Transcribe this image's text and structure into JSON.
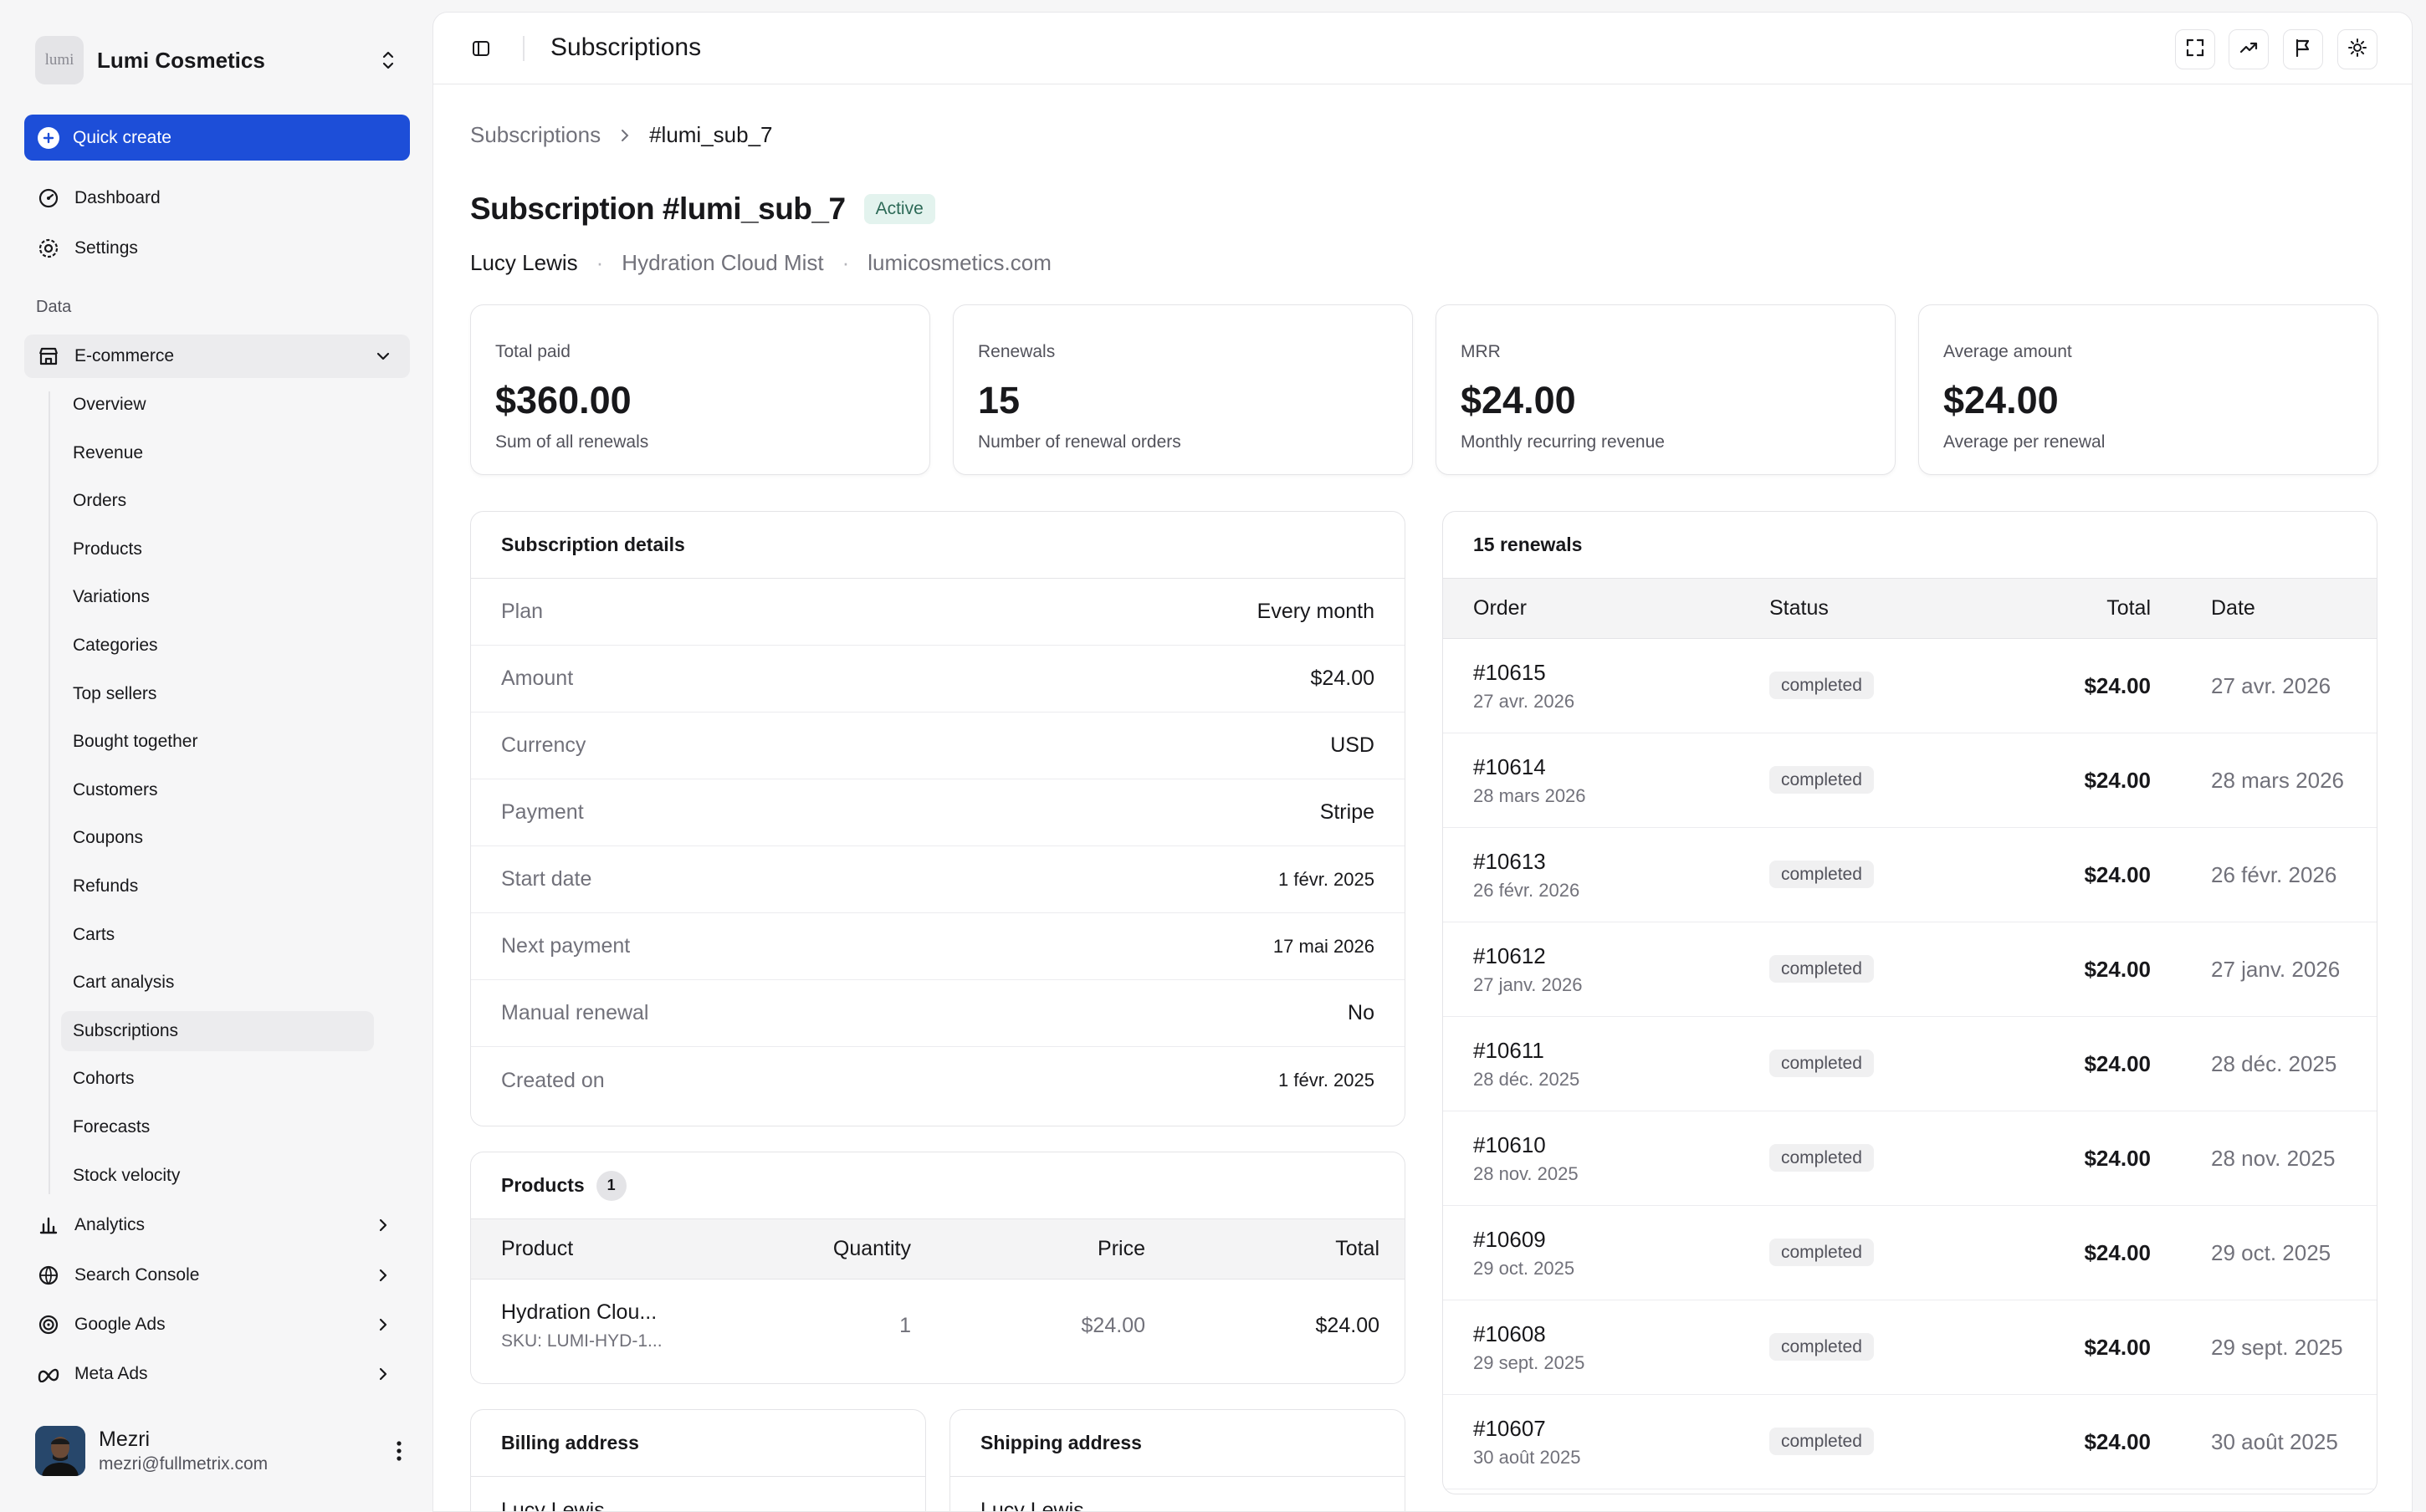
{
  "sidebar": {
    "brand": {
      "logo_text": "lumi",
      "name": "Lumi Cosmetics"
    },
    "quick_create": "Quick create",
    "top_items": [
      {
        "label": "Dashboard",
        "icon": "dashboard-icon"
      },
      {
        "label": "Settings",
        "icon": "gear-icon"
      }
    ],
    "section_label": "Data",
    "ecommerce": {
      "label": "E-commerce",
      "items": [
        "Overview",
        "Revenue",
        "Orders",
        "Products",
        "Variations",
        "Categories",
        "Top sellers",
        "Bought together",
        "Customers",
        "Coupons",
        "Refunds",
        "Carts",
        "Cart analysis",
        "Subscriptions",
        "Cohorts",
        "Forecasts",
        "Stock velocity"
      ],
      "active": "Subscriptions"
    },
    "groups": [
      {
        "label": "Analytics",
        "icon": "bar-chart-icon"
      },
      {
        "label": "Search Console",
        "icon": "search-console-icon"
      },
      {
        "label": "Google Ads",
        "icon": "google-ads-icon"
      },
      {
        "label": "Meta Ads",
        "icon": "meta-icon"
      }
    ],
    "user": {
      "name": "Mezri",
      "email": "mezri@fullmetrix.com"
    }
  },
  "topbar": {
    "title": "Subscriptions"
  },
  "breadcrumb": {
    "parent": "Subscriptions",
    "current": "#lumi_sub_7"
  },
  "header": {
    "title": "Subscription #lumi_sub_7",
    "status": "Active",
    "customer": "Lucy Lewis",
    "product": "Hydration Cloud Mist",
    "domain": "lumicosmetics.com"
  },
  "stats": [
    {
      "label": "Total paid",
      "value": "$360.00",
      "desc": "Sum of all renewals"
    },
    {
      "label": "Renewals",
      "value": "15",
      "desc": "Number of renewal orders"
    },
    {
      "label": "MRR",
      "value": "$24.00",
      "desc": "Monthly recurring revenue"
    },
    {
      "label": "Average amount",
      "value": "$24.00",
      "desc": "Average per renewal"
    }
  ],
  "details": {
    "title": "Subscription details",
    "rows": [
      {
        "k": "Plan",
        "v": "Every month"
      },
      {
        "k": "Amount",
        "v": "$24.00"
      },
      {
        "k": "Currency",
        "v": "USD"
      },
      {
        "k": "Payment",
        "v": "Stripe"
      },
      {
        "k": "Start date",
        "v": "1 févr. 2025"
      },
      {
        "k": "Next payment",
        "v": "17 mai 2026"
      },
      {
        "k": "Manual renewal",
        "v": "No"
      },
      {
        "k": "Created on",
        "v": "1 févr. 2025"
      }
    ]
  },
  "products": {
    "title": "Products",
    "count": "1",
    "headers": {
      "product": "Product",
      "quantity": "Quantity",
      "price": "Price",
      "total": "Total"
    },
    "rows": [
      {
        "name": "Hydration Clou...",
        "sku": "SKU: LUMI-HYD-1...",
        "quantity": "1",
        "price": "$24.00",
        "total": "$24.00"
      }
    ]
  },
  "addresses": {
    "billing": {
      "title": "Billing address",
      "name": "Lucy Lewis"
    },
    "shipping": {
      "title": "Shipping address",
      "name": "Lucy Lewis"
    }
  },
  "renewals": {
    "title": "15 renewals",
    "headers": {
      "order": "Order",
      "status": "Status",
      "total": "Total",
      "date": "Date"
    },
    "rows": [
      {
        "id": "#10615",
        "sub": "27 avr. 2026",
        "status": "completed",
        "total": "$24.00",
        "date": "27 avr. 2026"
      },
      {
        "id": "#10614",
        "sub": "28 mars 2026",
        "status": "completed",
        "total": "$24.00",
        "date": "28 mars 2026"
      },
      {
        "id": "#10613",
        "sub": "26 févr. 2026",
        "status": "completed",
        "total": "$24.00",
        "date": "26 févr. 2026"
      },
      {
        "id": "#10612",
        "sub": "27 janv. 2026",
        "status": "completed",
        "total": "$24.00",
        "date": "27 janv. 2026"
      },
      {
        "id": "#10611",
        "sub": "28 déc. 2025",
        "status": "completed",
        "total": "$24.00",
        "date": "28 déc. 2025"
      },
      {
        "id": "#10610",
        "sub": "28 nov. 2025",
        "status": "completed",
        "total": "$24.00",
        "date": "28 nov. 2025"
      },
      {
        "id": "#10609",
        "sub": "29 oct. 2025",
        "status": "completed",
        "total": "$24.00",
        "date": "29 oct. 2025"
      },
      {
        "id": "#10608",
        "sub": "29 sept. 2025",
        "status": "completed",
        "total": "$24.00",
        "date": "29 sept. 2025"
      },
      {
        "id": "#10607",
        "sub": "30 août 2025",
        "status": "completed",
        "total": "$24.00",
        "date": "30 août 2025"
      }
    ]
  },
  "colors": {
    "accent": "#1d4ed8",
    "active_badge_bg": "#e3f3ee",
    "active_badge_text": "#2d6a57"
  }
}
